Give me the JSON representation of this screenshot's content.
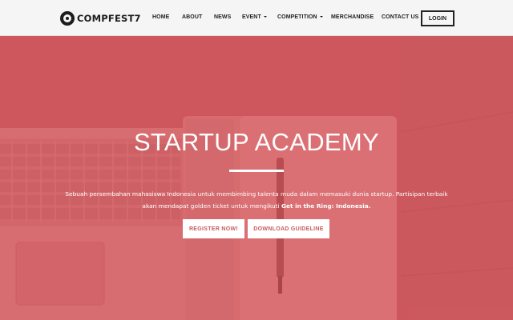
{
  "brand": {
    "name": "COMPFEST7"
  },
  "nav": {
    "home": "HOME",
    "about": "ABOUT",
    "news": "NEWS",
    "event": "EVENT",
    "competition": "COMPETITION",
    "merchandise": "MERCHANDISE",
    "contact": "CONTACT US",
    "login": "LOGIN"
  },
  "hero": {
    "title": "STARTUP ACADEMY",
    "desc_line1": "Sebuah persembahan mahasiswa Indonesia untuk membimbing talenta muda dalam memasuki dunia startup. Partisipan terbaik",
    "desc_line2_plain": "akan mendapat golden ticket untuk mengikuti ",
    "desc_line2_bold": "Get in the Ring: Indonesia.",
    "register_label": "REGISTER NOW!",
    "download_label": "DOWNLOAD GUIDELINE"
  },
  "colors": {
    "accent": "#c85a5e",
    "navbar": "#f5f5f5",
    "text_dark": "#222222"
  },
  "icons": {
    "logo": "compfest-logo-icon",
    "dropdown": "chevron-down-icon"
  }
}
